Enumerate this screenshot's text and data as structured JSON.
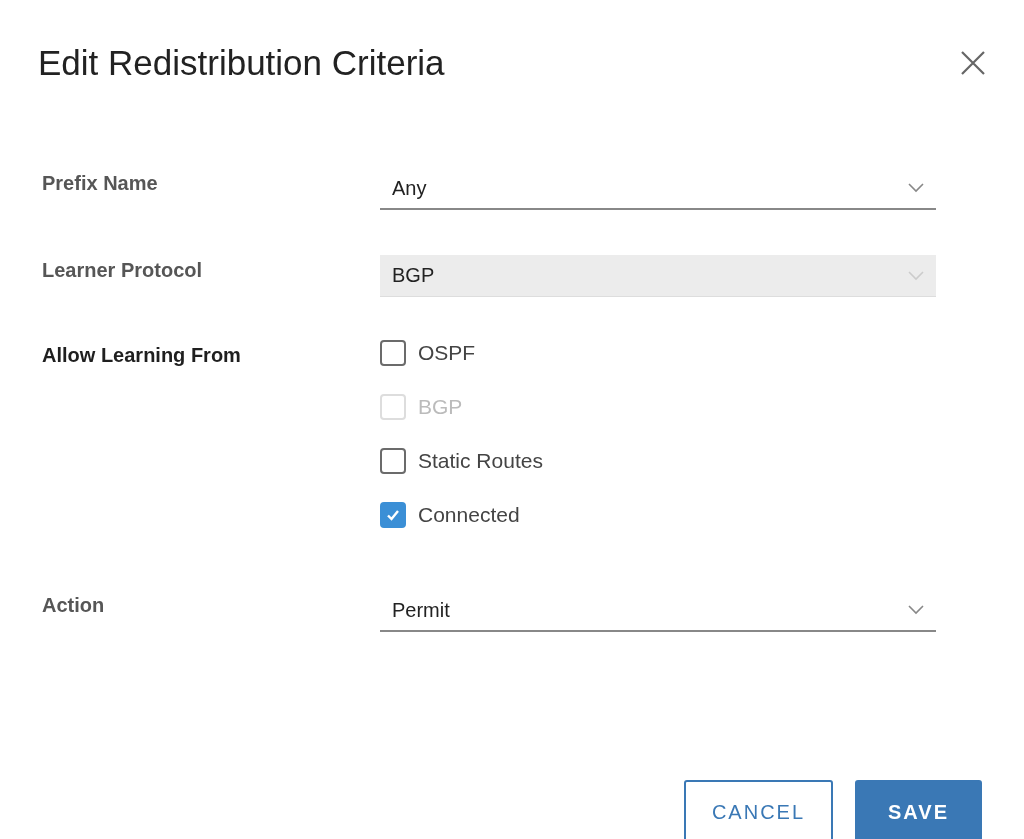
{
  "dialog": {
    "title": "Edit Redistribution Criteria"
  },
  "fields": [
    {
      "label": "Prefix Name",
      "kind": "select",
      "value": "Any",
      "disabled": false
    },
    {
      "label": "Learner Protocol",
      "kind": "select",
      "value": "BGP",
      "disabled": true
    },
    {
      "label": "Allow Learning From",
      "kind": "checkboxes",
      "options": [
        {
          "label": "OSPF",
          "checked": false,
          "disabled": false
        },
        {
          "label": "BGP",
          "checked": false,
          "disabled": true
        },
        {
          "label": "Static Routes",
          "checked": false,
          "disabled": false
        },
        {
          "label": "Connected",
          "checked": true,
          "disabled": false
        }
      ]
    },
    {
      "label": "Action",
      "kind": "select",
      "value": "Permit",
      "disabled": false
    }
  ],
  "buttons": [
    {
      "label": "CANCEL",
      "kind": "secondary"
    },
    {
      "label": "SAVE",
      "kind": "primary"
    }
  ]
}
